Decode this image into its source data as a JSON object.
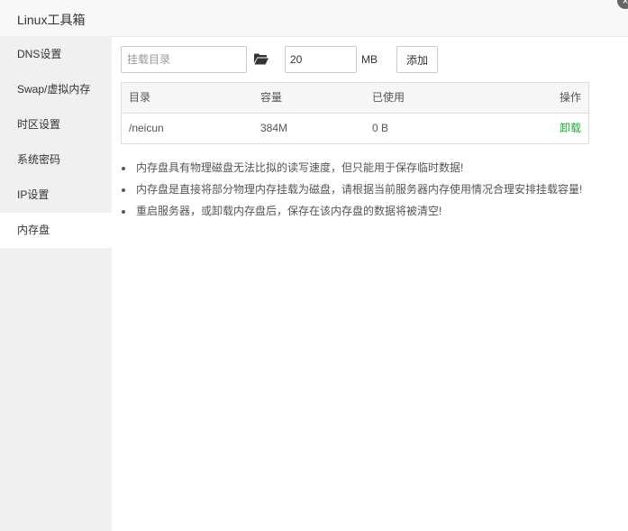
{
  "window": {
    "title": "Linux工具箱",
    "close_glyph": "×"
  },
  "sidebar": {
    "items": [
      {
        "label": "DNS设置"
      },
      {
        "label": "Swap/虚拟内存"
      },
      {
        "label": "时区设置"
      },
      {
        "label": "系统密码"
      },
      {
        "label": "IP设置"
      },
      {
        "label": "内存盘"
      }
    ],
    "active_index": 5
  },
  "form": {
    "dir_placeholder": "挂载目录",
    "dir_value": "",
    "size_value": "20",
    "unit": "MB",
    "add_label": "添加"
  },
  "table": {
    "headers": [
      "目录",
      "容量",
      "已使用",
      "操作"
    ],
    "rows": [
      {
        "dir": "/neicun",
        "size": "384M",
        "used": "0 B",
        "action": "卸载"
      }
    ]
  },
  "tips": [
    "内存盘具有物理磁盘无法比拟的读写速度，但只能用于保存临时数据!",
    "内存盘是直接将部分物理内存挂载为磁盘，请根据当前服务器内存使用情况合理安排挂载容量!",
    "重启服务器，或卸载内存盘后，保存在该内存盘的数据将被清空!"
  ],
  "colors": {
    "accent": "#20a53a",
    "sidebar_bg": "#f0f0f0",
    "header_bg": "#f8f8f8"
  }
}
